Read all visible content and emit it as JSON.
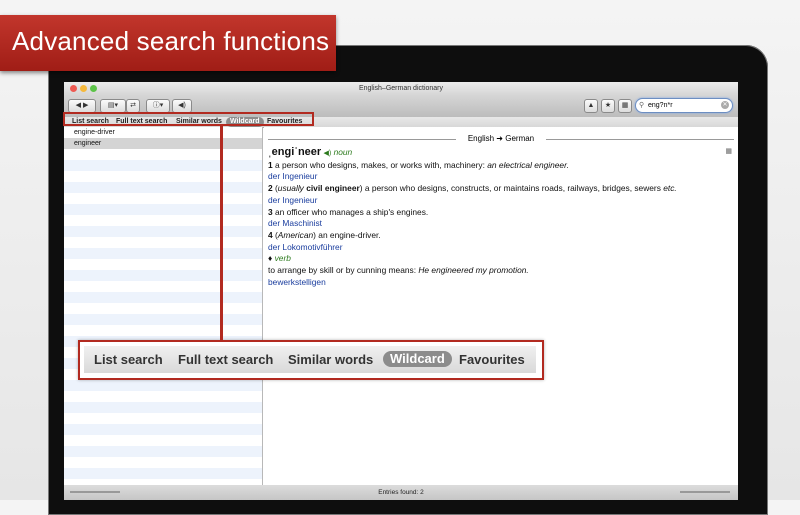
{
  "banner": {
    "text": "Advanced search functions"
  },
  "window": {
    "title": "English–German dictionary"
  },
  "search": {
    "value": "eng?n*r"
  },
  "tabs": [
    "List search",
    "Full text search",
    "Similar words",
    "Wildcard",
    "Favourites"
  ],
  "selected_tab": "Wildcard",
  "results": [
    "engine-driver",
    "engineer"
  ],
  "selected_result": "engineer",
  "dictionary": {
    "direction": "English ➜ German",
    "headword": "ˌengiˈneer",
    "pos_noun": "noun",
    "senses": [
      {
        "num": "1",
        "text": "a person who designs, makes, or works with, machinery: ",
        "example": "an electrical engineer.",
        "translation": "der Ingenieur"
      },
      {
        "num": "2",
        "pre": "(",
        "label": "usually",
        "bold": " civil engineer",
        "text": ") a person who designs, constructs, or maintains roads, railways, bridges, sewers ",
        "etc": "etc.",
        "translation": "der Ingenieur"
      },
      {
        "num": "3",
        "text": "an officer who manages a ship's engines.",
        "translation": "der Maschinist"
      },
      {
        "num": "4",
        "pre": "(",
        "label": "American",
        "text": ") an engine-driver.",
        "translation": "der Lokomotivführer"
      }
    ],
    "verb_marker": "♦",
    "pos_verb": "verb",
    "verb_text": "to arrange by skill or by cunning means: ",
    "verb_example": "He engineered my promotion.",
    "verb_translation": "bewerkstelligen"
  },
  "status": {
    "entries": "Entries found: 2"
  },
  "colors": {
    "banner": "#b0261d",
    "translation": "#1a3d9e",
    "pos": "#2c7a1d",
    "callout_border": "#b22a20"
  }
}
